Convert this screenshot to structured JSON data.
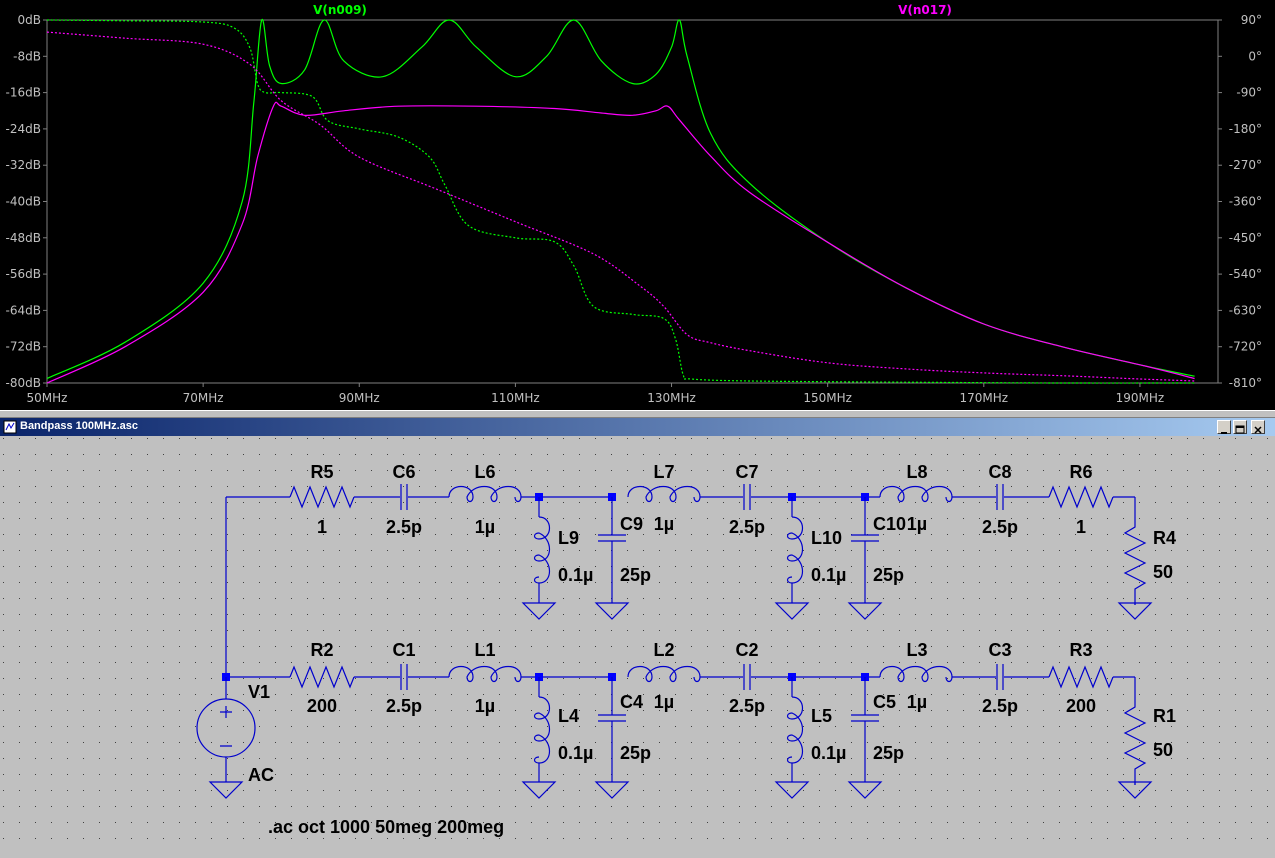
{
  "plot": {
    "traces": [
      {
        "name": "V(n009)",
        "color": "#00ff00"
      },
      {
        "name": "V(n017)",
        "color": "#ff00ff"
      }
    ],
    "y_left_ticks": [
      "0dB",
      "-8dB",
      "-16dB",
      "-24dB",
      "-32dB",
      "-40dB",
      "-48dB",
      "-56dB",
      "-64dB",
      "-72dB",
      "-80dB"
    ],
    "y_right_ticks": [
      "90°",
      "0°",
      "-90°",
      "-180°",
      "-270°",
      "-360°",
      "-450°",
      "-540°",
      "-630°",
      "-720°",
      "-810°"
    ],
    "x_ticks": [
      "50MHz",
      "70MHz",
      "90MHz",
      "110MHz",
      "130MHz",
      "150MHz",
      "170MHz",
      "190MHz"
    ]
  },
  "chart_data": {
    "type": "line",
    "xlabel": "",
    "ylabel": "",
    "xlim": [
      50,
      200
    ],
    "ylim": [
      -80,
      0
    ],
    "y2lim": [
      -810,
      90
    ],
    "grid": false,
    "series": [
      {
        "name": "V(n009)",
        "kind": "magnitude",
        "axis": "left",
        "x": [
          50,
          60,
          70,
          75,
          76.5,
          77.5,
          78.5,
          80,
          83,
          85.5,
          88,
          93,
          98,
          101.5,
          105,
          110,
          114,
          117.5,
          121,
          125,
          128,
          130,
          131,
          132,
          135,
          140,
          150,
          160,
          170,
          180,
          190,
          197
        ],
        "y": [
          -79,
          -71,
          -58,
          -40,
          -18,
          0,
          -10,
          -14,
          -11,
          0,
          -9,
          -12.5,
          -6,
          0,
          -6,
          -12.5,
          -8,
          0,
          -9,
          -14,
          -12,
          -6,
          0,
          -8,
          -25,
          -36,
          -49,
          -59,
          -67,
          -72,
          -76,
          -78.5
        ]
      },
      {
        "name": "V(n017)",
        "kind": "magnitude",
        "axis": "left",
        "x": [
          50,
          60,
          70,
          75,
          77,
          79,
          80,
          83,
          88,
          95,
          105,
          115,
          121,
          125,
          128,
          129.5,
          131,
          135,
          140,
          150,
          160,
          170,
          180,
          190,
          197
        ],
        "y": [
          -80,
          -72,
          -60,
          -45,
          -30,
          -19,
          -19,
          -21,
          -20,
          -19,
          -19,
          -19.5,
          -20.5,
          -21,
          -20,
          -19,
          -22,
          -30,
          -38,
          -49,
          -59,
          -67,
          -72,
          -76,
          -79
        ]
      },
      {
        "name": "V(n009)",
        "kind": "phase",
        "axis": "right",
        "x": [
          50,
          60,
          70,
          74,
          76,
          77,
          78,
          80,
          84,
          86,
          90,
          95,
          99,
          101,
          104,
          110,
          115,
          117.5,
          120,
          125,
          129,
          130.5,
          131.5,
          132.5,
          140,
          160,
          180,
          197
        ],
        "y": [
          90,
          88,
          85,
          70,
          20,
          -70,
          -90,
          -90,
          -100,
          -160,
          -180,
          -200,
          -250,
          -320,
          -420,
          -450,
          -460,
          -520,
          -620,
          -640,
          -650,
          -700,
          -790,
          -800,
          -805,
          -808,
          -810,
          -810
        ]
      },
      {
        "name": "V(n017)",
        "kind": "phase",
        "axis": "right",
        "x": [
          50,
          60,
          70,
          76,
          80,
          85,
          90,
          100,
          110,
          120,
          126,
          129,
          132,
          135,
          140,
          150,
          160,
          170,
          180,
          190,
          197
        ],
        "y": [
          60,
          45,
          30,
          -20,
          -110,
          -170,
          -250,
          -330,
          -410,
          -490,
          -570,
          -620,
          -690,
          -710,
          -730,
          -760,
          -775,
          -785,
          -792,
          -800,
          -805
        ]
      }
    ]
  },
  "schematic": {
    "window_title": "Bandpass 100MHz.asc",
    "directive": ".ac oct 1000 50meg 200meg",
    "source": {
      "name": "V1",
      "value": "AC"
    },
    "top_row": [
      {
        "name": "R5",
        "value": "1"
      },
      {
        "name": "C6",
        "value": "2.5p"
      },
      {
        "name": "L6",
        "value": "1µ"
      },
      {
        "name": "L9",
        "value": "0.1µ"
      },
      {
        "name": "C9",
        "value": "25p"
      },
      {
        "name": "L7",
        "value": "1µ"
      },
      {
        "name": "C7",
        "value": "2.5p"
      },
      {
        "name": "L10",
        "value": "0.1µ"
      },
      {
        "name": "C10",
        "value": "25p"
      },
      {
        "name": "L8",
        "value": "1µ"
      },
      {
        "name": "C8",
        "value": "2.5p"
      },
      {
        "name": "R6",
        "value": "1"
      },
      {
        "name": "R4",
        "value": "50"
      }
    ],
    "bottom_row": [
      {
        "name": "R2",
        "value": "200"
      },
      {
        "name": "C1",
        "value": "2.5p"
      },
      {
        "name": "L1",
        "value": "1µ"
      },
      {
        "name": "L4",
        "value": "0.1µ"
      },
      {
        "name": "C4",
        "value": "25p"
      },
      {
        "name": "L2",
        "value": "1µ"
      },
      {
        "name": "C2",
        "value": "2.5p"
      },
      {
        "name": "L5",
        "value": "0.1µ"
      },
      {
        "name": "C5",
        "value": "25p"
      },
      {
        "name": "L3",
        "value": "1µ"
      },
      {
        "name": "C3",
        "value": "2.5p"
      },
      {
        "name": "R3",
        "value": "200"
      },
      {
        "name": "R1",
        "value": "50"
      }
    ]
  }
}
